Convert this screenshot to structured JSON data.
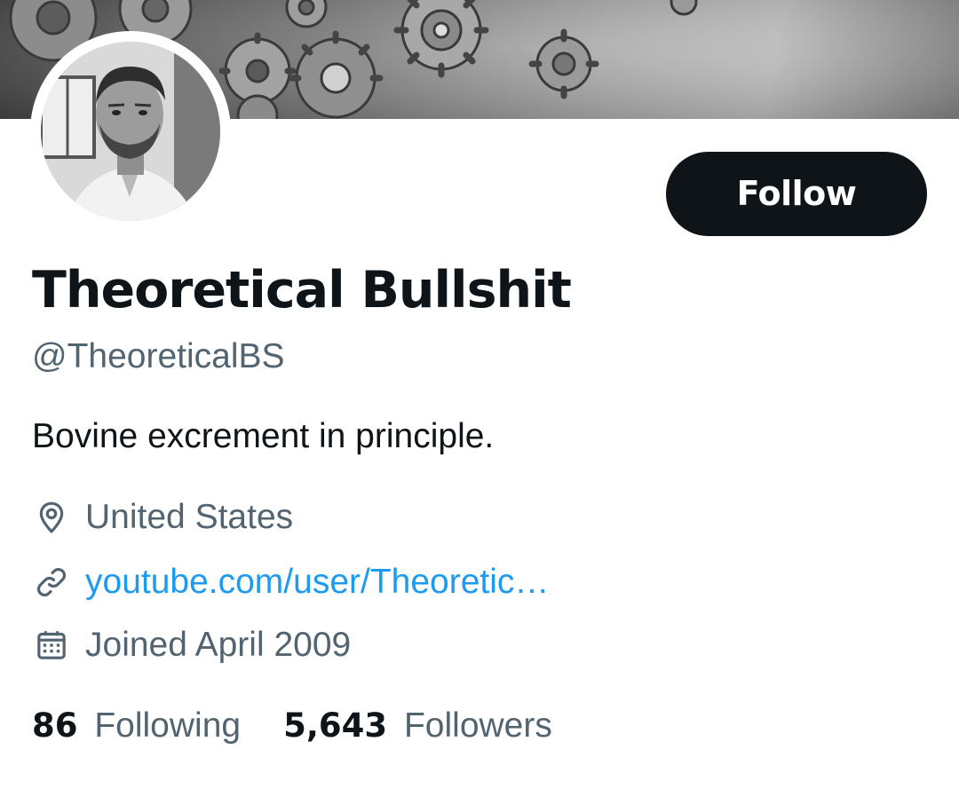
{
  "profile": {
    "display_name": "Theoretical Bullshit",
    "handle": "@TheoreticalBS",
    "bio": "Bovine excrement in principle.",
    "location": "United States",
    "website": "youtube.com/user/Theoretic…",
    "joined": "Joined April 2009"
  },
  "actions": {
    "follow_label": "Follow"
  },
  "stats": {
    "following_count": "86",
    "following_label": "Following",
    "followers_count": "5,643",
    "followers_label": "Followers"
  },
  "icons": {
    "location": "location-pin-icon",
    "website": "link-icon",
    "joined": "calendar-icon"
  },
  "colors": {
    "text_primary": "#0f1419",
    "text_secondary": "#536471",
    "link": "#1d9bf0",
    "follow_button_bg": "#0f1419",
    "follow_button_text": "#ffffff"
  }
}
